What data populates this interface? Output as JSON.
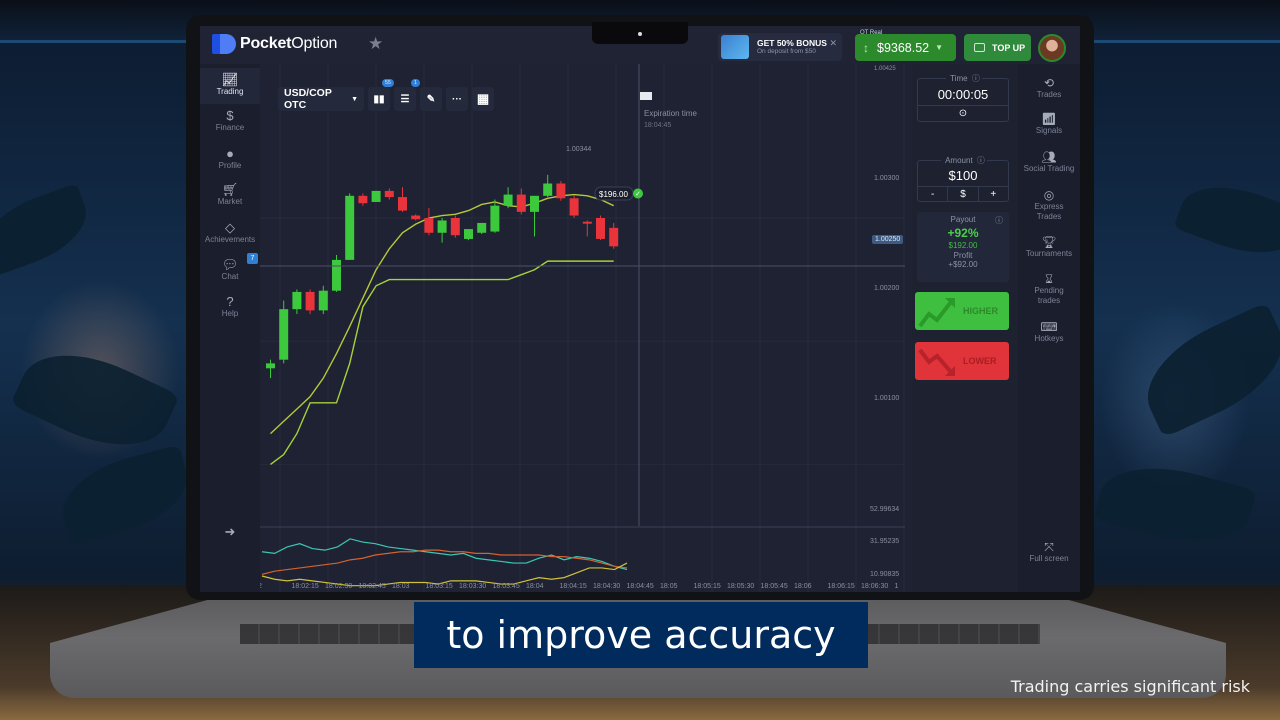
{
  "app": {
    "brand_bold": "Pocket",
    "brand_light": "Option"
  },
  "header": {
    "bonus_title": "GET 50% BONUS",
    "bonus_subtitle": "On deposit from $50",
    "account_label": "QT Real",
    "balance": "$9368.52",
    "top_up_label": "TOP UP"
  },
  "left_nav": {
    "items": [
      {
        "label": "Trading",
        "icon": "chart-line-icon",
        "active": true
      },
      {
        "label": "Finance",
        "icon": "dollar-icon"
      },
      {
        "label": "Profile",
        "icon": "user-icon"
      },
      {
        "label": "Market",
        "icon": "cart-icon"
      },
      {
        "label": "Achievements",
        "icon": "diamond-icon"
      },
      {
        "label": "Chat",
        "icon": "chat-icon",
        "badge": "7"
      },
      {
        "label": "Help",
        "icon": "help-icon"
      }
    ],
    "logout_icon": "logout-icon"
  },
  "toolbar": {
    "asset": "USD/COP OTC",
    "indicators_badge": "55",
    "settings_badge": "1"
  },
  "chart": {
    "expiration_label": "Expiration time",
    "expiration_time": "18:04:45",
    "high_label": "1.00344",
    "trade_amount_label": "$196.00",
    "current_price": "1.00250",
    "price_ticks": [
      "1.00300",
      "1.00200",
      "1.00100"
    ],
    "top_tick": "1.00425",
    "oscillator_ticks": [
      "52.99634",
      "31.95235",
      "10.90835"
    ],
    "time_ticks": [
      "2",
      "18:02:15",
      "18:02:30",
      "18:02:45",
      "18:03",
      "18:03:15",
      "18:03:30",
      "18:03:45",
      "18:04",
      "18:04:15",
      "18:04:30",
      "18:04:45",
      "18:05",
      "18:05:15",
      "18:05:30",
      "18:05:45",
      "18:06",
      "18:06:15",
      "18:06:30",
      "1"
    ]
  },
  "chart_data": {
    "type": "candlestick",
    "title": "USD/COP OTC",
    "ylim": [
      1.0005,
      1.00425
    ],
    "candles": [
      {
        "o": 1.00178,
        "h": 1.00185,
        "c": 1.00182,
        "l": 1.0017,
        "dir": "up"
      },
      {
        "o": 1.00185,
        "h": 1.00233,
        "c": 1.00226,
        "l": 1.00182,
        "dir": "up"
      },
      {
        "o": 1.00226,
        "h": 1.00242,
        "c": 1.0024,
        "l": 1.00222,
        "dir": "up"
      },
      {
        "o": 1.0024,
        "h": 1.00242,
        "c": 1.00225,
        "l": 1.00222,
        "dir": "down"
      },
      {
        "o": 1.00225,
        "h": 1.00245,
        "c": 1.00241,
        "l": 1.00222,
        "dir": "up"
      },
      {
        "o": 1.00241,
        "h": 1.0027,
        "c": 1.00266,
        "l": 1.0024,
        "dir": "up"
      },
      {
        "o": 1.00266,
        "h": 1.0032,
        "c": 1.00318,
        "l": 1.00266,
        "dir": "up"
      },
      {
        "o": 1.00318,
        "h": 1.0032,
        "c": 1.00312,
        "l": 1.0031,
        "dir": "down"
      },
      {
        "o": 1.00313,
        "h": 1.00322,
        "c": 1.00322,
        "l": 1.00313,
        "dir": "up"
      },
      {
        "o": 1.00322,
        "h": 1.00324,
        "c": 1.00317,
        "l": 1.00315,
        "dir": "down"
      },
      {
        "o": 1.00317,
        "h": 1.00325,
        "c": 1.00306,
        "l": 1.00305,
        "dir": "down"
      },
      {
        "o": 1.00302,
        "h": 1.00303,
        "c": 1.00299,
        "l": 1.00298,
        "dir": "down"
      },
      {
        "o": 1.003,
        "h": 1.00308,
        "c": 1.00288,
        "l": 1.00286,
        "dir": "down"
      },
      {
        "o": 1.00288,
        "h": 1.003,
        "c": 1.00298,
        "l": 1.0028,
        "dir": "up"
      },
      {
        "o": 1.003,
        "h": 1.00302,
        "c": 1.00286,
        "l": 1.00284,
        "dir": "down"
      },
      {
        "o": 1.00283,
        "h": 1.00291,
        "c": 1.00291,
        "l": 1.00282,
        "dir": "up"
      },
      {
        "o": 1.00288,
        "h": 1.00296,
        "c": 1.00296,
        "l": 1.00287,
        "dir": "up"
      },
      {
        "o": 1.00289,
        "h": 1.00315,
        "c": 1.0031,
        "l": 1.00288,
        "dir": "up"
      },
      {
        "o": 1.0031,
        "h": 1.00325,
        "c": 1.00319,
        "l": 1.00308,
        "dir": "up"
      },
      {
        "o": 1.00319,
        "h": 1.00324,
        "c": 1.00305,
        "l": 1.00303,
        "dir": "down"
      },
      {
        "o": 1.00305,
        "h": 1.00318,
        "c": 1.00318,
        "l": 1.00285,
        "dir": "up"
      },
      {
        "o": 1.00318,
        "h": 1.00335,
        "c": 1.00328,
        "l": 1.00317,
        "dir": "up"
      },
      {
        "o": 1.00328,
        "h": 1.0033,
        "c": 1.00316,
        "l": 1.00314,
        "dir": "down"
      },
      {
        "o": 1.00316,
        "h": 1.00318,
        "c": 1.00302,
        "l": 1.003,
        "dir": "down"
      },
      {
        "o": 1.00297,
        "h": 1.00298,
        "c": 1.00296,
        "l": 1.00285,
        "dir": "down"
      },
      {
        "o": 1.003,
        "h": 1.00302,
        "c": 1.00283,
        "l": 1.00282,
        "dir": "down"
      },
      {
        "o": 1.00292,
        "h": 1.00296,
        "c": 1.00277,
        "l": 1.00275,
        "dir": "down"
      }
    ],
    "ma_fast": [
      1.00125,
      1.00135,
      1.00145,
      1.00155,
      1.0017,
      1.0019,
      1.00212,
      1.00235,
      1.00258,
      1.00275,
      1.00288,
      1.00295,
      1.003,
      1.00302,
      1.00303,
      1.00306,
      1.00311,
      1.00313,
      1.0031,
      1.00309,
      1.00312,
      1.00316,
      1.00318,
      1.00319,
      1.00318,
      1.00315,
      1.0031
    ],
    "ma_slow": [
      1.001,
      1.00108,
      1.00125,
      1.0015,
      1.0015,
      1.0015,
      1.00182,
      1.00228,
      1.00245,
      1.0025,
      1.0025,
      1.0025,
      1.0025,
      1.0025,
      1.0025,
      1.0025,
      1.0025,
      1.0025,
      1.0025,
      1.00254,
      1.00258,
      1.00265,
      1.00265,
      1.00265,
      1.00265,
      1.00265,
      1.00265
    ],
    "oscillator": {
      "ylim": [
        10.90835,
        52.99634
      ],
      "series": [
        {
          "name": "cyan",
          "color": "#3cc7b4",
          "values": [
            42,
            41,
            45,
            47,
            44,
            43,
            45,
            50,
            48,
            47,
            45,
            44,
            43,
            42,
            41,
            40,
            41,
            38,
            37,
            36,
            35,
            35,
            38,
            40,
            37,
            39,
            38,
            36,
            33,
            31
          ]
        },
        {
          "name": "orange",
          "color": "#d2622f",
          "values": [
            28,
            30,
            31,
            32,
            33,
            34,
            35,
            37,
            38,
            40,
            41,
            42,
            42,
            43,
            43,
            42,
            42,
            41,
            41,
            40,
            40,
            40,
            40,
            39,
            39,
            38,
            37,
            35,
            33,
            32
          ]
        },
        {
          "name": "yellow",
          "color": "#cfc23a",
          "values": [
            27,
            25,
            24,
            25,
            24,
            23,
            22,
            21,
            21,
            21,
            22,
            23,
            23,
            23,
            22,
            24,
            24,
            24,
            23,
            22,
            22,
            24,
            26,
            25,
            26,
            29,
            32,
            32,
            31,
            35
          ]
        }
      ]
    }
  },
  "trade_panel": {
    "time_label": "Time",
    "time_value": "00:00:05",
    "amount_label": "Amount",
    "amount_value": "$100",
    "amount_minus": "-",
    "amount_currency": "$",
    "amount_plus": "+",
    "payout_label": "Payout",
    "payout_percent": "+92%",
    "payout_amount": "$192.00",
    "profit_label": "Profit",
    "profit_amount": "+$92.00",
    "higher_label": "HIGHER",
    "lower_label": "LOWER"
  },
  "right_nav": {
    "items": [
      {
        "label": "Trades",
        "icon": "history-icon"
      },
      {
        "label": "Signals",
        "icon": "antenna-icon"
      },
      {
        "label": "Social Trading",
        "icon": "users-icon"
      },
      {
        "label": "Express Trades",
        "icon": "target-icon"
      },
      {
        "label": "Tournaments",
        "icon": "trophy-icon"
      },
      {
        "label": "Pending trades",
        "icon": "hourglass-icon"
      },
      {
        "label": "Hotkeys",
        "icon": "keyboard-icon"
      }
    ],
    "full_screen_label": "Full screen"
  },
  "overlay": {
    "subtitle": "to improve accuracy",
    "disclaimer": "Trading carries significant risk"
  },
  "colors": {
    "up": "#3dc93d",
    "down": "#e8343a",
    "ma_fast": "#b5c93a",
    "ma_slow": "#a8d13a",
    "accent": "#2f7fd6",
    "balance": "#2c8a2c"
  }
}
